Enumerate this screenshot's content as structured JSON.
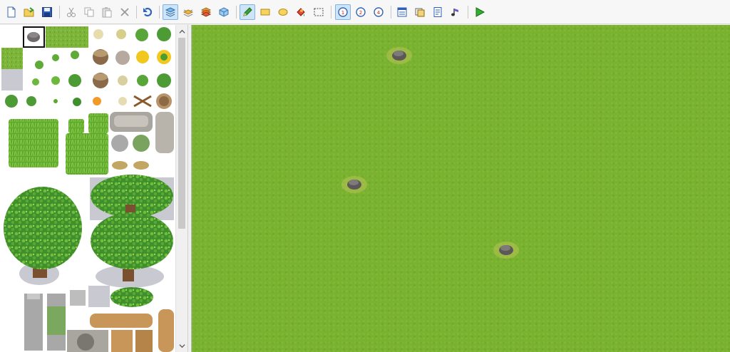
{
  "window": {
    "toolbar": {
      "groups": [
        [
          "new-file-icon",
          "open-project-icon",
          "save-icon"
        ],
        [
          "cut-icon",
          "copy-icon",
          "paste-icon",
          "delete-icon"
        ],
        [
          "undo-icon"
        ],
        [
          "layer-1-icon",
          "layer-2-icon",
          "layer-3-icon",
          "event-layer-icon"
        ],
        [
          "pencil-icon",
          "rectangle-icon",
          "ellipse-icon",
          "fill-icon",
          "select-icon"
        ],
        [
          "zoom-in-icon",
          "zoom-out-icon",
          "zoom-actual-icon"
        ],
        [
          "database-icon",
          "resource-manager-icon",
          "script-editor-icon",
          "sound-test-icon"
        ],
        [
          "play-test-icon"
        ]
      ],
      "active_tools": [
        "layer-1-icon",
        "pencil-icon",
        "zoom-in-icon"
      ]
    },
    "palette": {
      "selected_tile": "stump-tile"
    },
    "map": {
      "ground": "grass",
      "objects": [
        "stump",
        "stump",
        "stump"
      ]
    },
    "colors": {
      "grass": "#78b22e",
      "selection_highlight": "#cfe5f7",
      "selection_border": "#7eb4e3",
      "play_green": "#2fae2f",
      "pencil_green": "#3aa33a"
    }
  }
}
